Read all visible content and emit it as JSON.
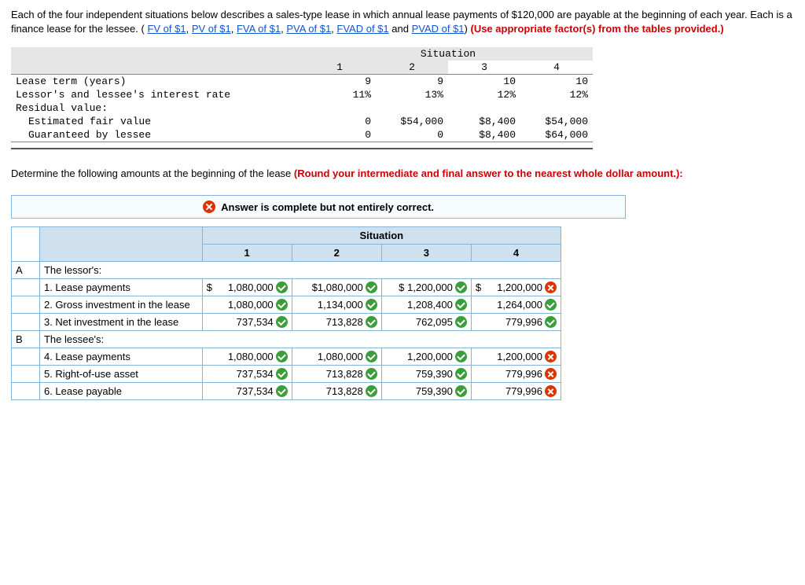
{
  "intro": {
    "pre": "Each of the four independent situations below describes a sales-type lease in which annual lease payments of $120,000 are payable at the beginning of each year. Each is a finance lease for the lessee. (",
    "links": [
      "FV of $1",
      "PV of $1",
      "FVA of $1",
      "PVA of $1",
      "FVAD of $1",
      "PVAD of $1"
    ],
    "post_start": ") ",
    "post_red": "(Use appropriate factor(s) from the tables provided.)"
  },
  "sit": {
    "header": "Situation",
    "cols": [
      "1",
      "2",
      "3",
      "4"
    ],
    "rows": {
      "lease_term": {
        "label": "Lease term (years)",
        "v": [
          "9",
          "9",
          "10",
          "10"
        ]
      },
      "rate": {
        "label": "Lessor's and lessee's interest rate",
        "v": [
          "11%",
          "13%",
          "12%",
          "12%"
        ]
      },
      "residual_label": {
        "label": "Residual value:"
      },
      "est_fair": {
        "label": "  Estimated fair value",
        "v": [
          "0",
          "$54,000",
          "$8,400",
          "$54,000"
        ]
      },
      "guaranteed": {
        "label": "  Guaranteed by lessee",
        "v": [
          "0",
          "0",
          "$8,400",
          "$64,000"
        ]
      }
    }
  },
  "determine": {
    "text": "Determine the following amounts at the beginning of the lease ",
    "red": "(Round your intermediate and final answer to the nearest whole dollar amount.):"
  },
  "feedback": "Answer is complete but not entirely correct.",
  "ans": {
    "header": "Situation",
    "cols": [
      "1",
      "2",
      "3",
      "4"
    ],
    "sections": {
      "A": {
        "code": "A",
        "title": "The lessor's:"
      },
      "B": {
        "code": "B",
        "title": "The lessee's:"
      }
    },
    "rows": [
      {
        "sec": "A",
        "label": "1. Lease payments",
        "v": [
          {
            "t": "$ 1,080,000",
            "s": "ok",
            "dl": true
          },
          {
            "t": "$1,080,000",
            "s": "ok"
          },
          {
            "t": "$ 1,200,000",
            "s": "ok"
          },
          {
            "t": "$ 1,200,000",
            "s": "bad",
            "dl": true
          }
        ]
      },
      {
        "sec": "A",
        "label": "2. Gross investment in the lease",
        "v": [
          {
            "t": "1,080,000",
            "s": "ok"
          },
          {
            "t": "1,134,000",
            "s": "ok"
          },
          {
            "t": "1,208,400",
            "s": "ok"
          },
          {
            "t": "1,264,000",
            "s": "ok"
          }
        ]
      },
      {
        "sec": "A",
        "label": "3. Net investment in the lease",
        "v": [
          {
            "t": "737,534",
            "s": "ok"
          },
          {
            "t": "713,828",
            "s": "ok"
          },
          {
            "t": "762,095",
            "s": "ok"
          },
          {
            "t": "779,996",
            "s": "ok"
          }
        ]
      },
      {
        "sec": "B",
        "label": "4. Lease payments",
        "v": [
          {
            "t": "1,080,000",
            "s": "ok"
          },
          {
            "t": "1,080,000",
            "s": "ok"
          },
          {
            "t": "1,200,000",
            "s": "ok"
          },
          {
            "t": "1,200,000",
            "s": "bad"
          }
        ]
      },
      {
        "sec": "B",
        "label": "5. Right-of-use asset",
        "v": [
          {
            "t": "737,534",
            "s": "ok"
          },
          {
            "t": "713,828",
            "s": "ok"
          },
          {
            "t": "759,390",
            "s": "ok"
          },
          {
            "t": "779,996",
            "s": "bad"
          }
        ]
      },
      {
        "sec": "B",
        "label": "6. Lease payable",
        "v": [
          {
            "t": "737,534",
            "s": "ok"
          },
          {
            "t": "713,828",
            "s": "ok"
          },
          {
            "t": "759,390",
            "s": "ok"
          },
          {
            "t": "779,996",
            "s": "bad"
          }
        ]
      }
    ]
  }
}
